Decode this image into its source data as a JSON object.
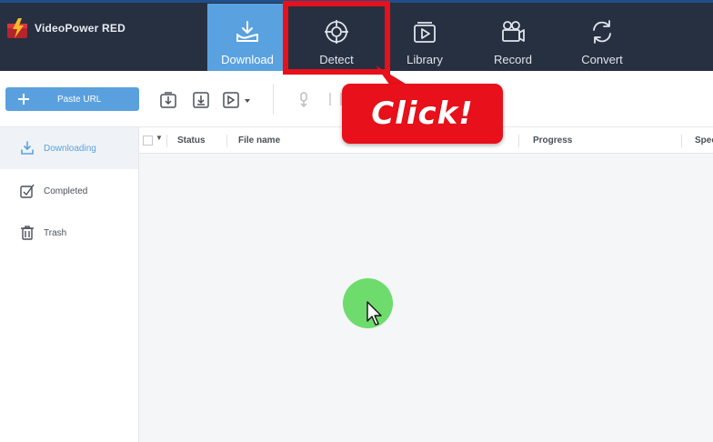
{
  "app": {
    "title": "VideoPower RED"
  },
  "nav": {
    "tabs": [
      {
        "label": "Download",
        "icon": "download-tray-icon",
        "active": true
      },
      {
        "label": "Detect",
        "icon": "crosshair-icon",
        "active": false
      },
      {
        "label": "Library",
        "icon": "video-library-icon",
        "active": false
      },
      {
        "label": "Record",
        "icon": "video-camera-icon",
        "active": false
      },
      {
        "label": "Convert",
        "icon": "refresh-convert-icon",
        "active": false
      }
    ]
  },
  "toolbar": {
    "paste_label": "Paste URL",
    "icons": [
      "download-box-icon",
      "download-square-icon",
      "video-download-icon",
      "mic-download-icon",
      "pause-icon"
    ]
  },
  "sidebar": {
    "items": [
      {
        "label": "Downloading",
        "icon": "download-arrow-icon",
        "active": true
      },
      {
        "label": "Completed",
        "icon": "check-icon",
        "active": false
      },
      {
        "label": "Trash",
        "icon": "trash-icon",
        "active": false
      }
    ]
  },
  "table": {
    "columns": [
      "Status",
      "File name",
      "Progress",
      "Spee"
    ]
  },
  "overlay": {
    "callout_text": "Click!",
    "highlight_color": "#e8101a",
    "click_indicator_color": "#6ddc6c"
  },
  "colors": {
    "header_bg": "#263041",
    "accent": "#5aa2df",
    "paste_button": "#5aa0de"
  }
}
